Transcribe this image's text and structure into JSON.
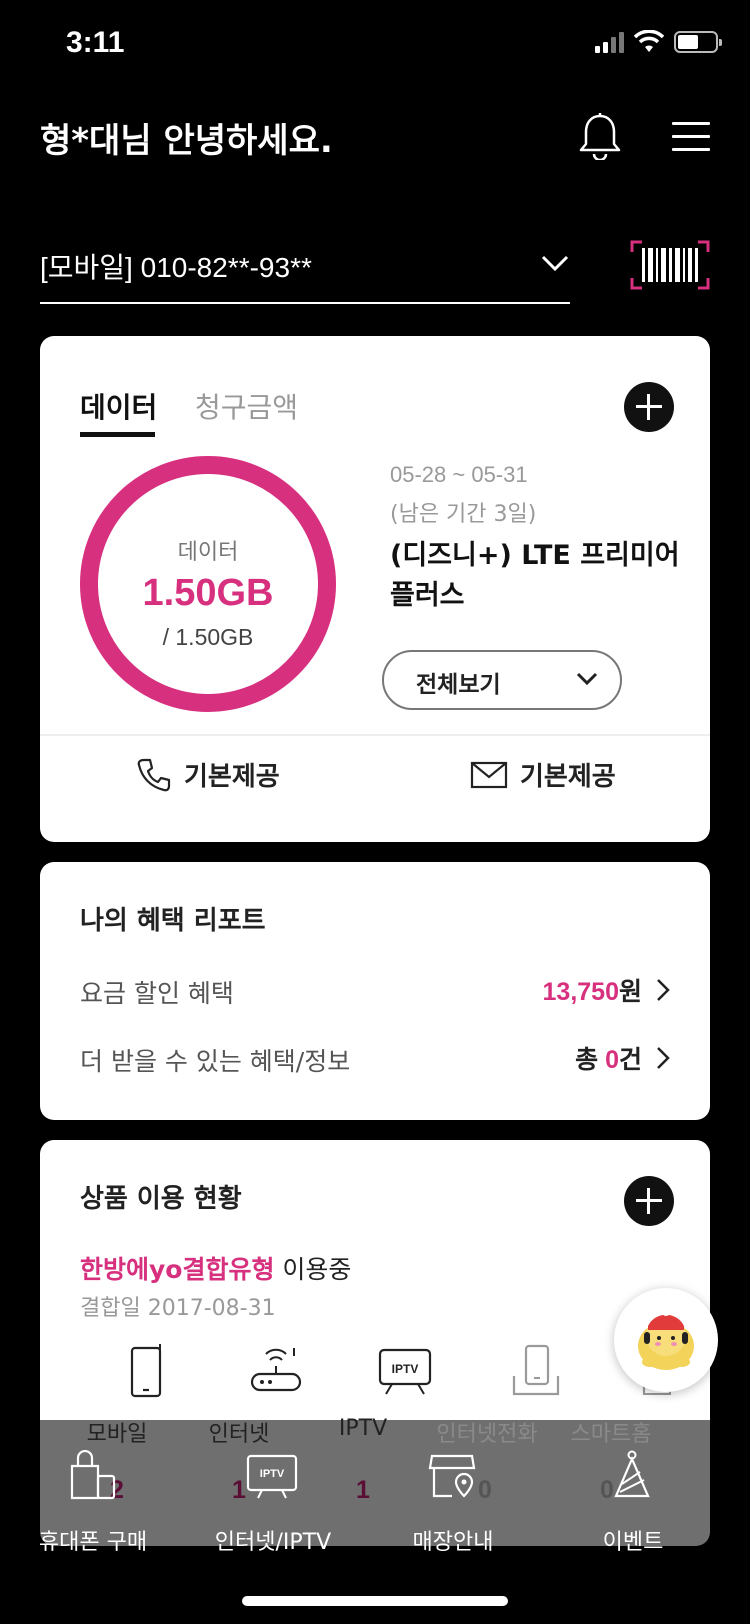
{
  "status_bar": {
    "time": "3:11"
  },
  "header": {
    "greeting": "형*대님 안녕하세요."
  },
  "line_selector": {
    "value": "[모바일] 010-82**-93**"
  },
  "usage_card": {
    "tabs": [
      {
        "label": "데이터",
        "active": true
      },
      {
        "label": "청구금액",
        "active": false
      }
    ],
    "ring": {
      "label": "데이터",
      "value": "1.50GB",
      "total": "/ 1.50GB",
      "fill_fraction": 1.0,
      "color": "#d6307e"
    },
    "period": "05-28 ~ 05-31",
    "remaining": "(남은 기간 3일)",
    "plan_name": "(디즈니+) LTE 프리미어 플러스",
    "view_all_label": "전체보기",
    "voice_label": "기본제공",
    "message_label": "기본제공"
  },
  "benefit_card": {
    "title": "나의 혜택 리포트",
    "rows": [
      {
        "label": "요금 할인 혜택",
        "amount": "13,750",
        "unit": "원"
      },
      {
        "label": "더 받을 수 있는 혜택/정보",
        "prefix": "총 ",
        "amount": "0",
        "unit": "건"
      }
    ]
  },
  "product_card": {
    "title": "상품 이용 현황",
    "bundle_name": "한방에yo결합유형",
    "bundle_suffix": " 이용중",
    "bundle_date": "결합일 2017-08-31",
    "products": [
      {
        "label": "모바일",
        "count": "2",
        "icon": "mobile-icon",
        "active": true
      },
      {
        "label": "인터넷",
        "count": "1",
        "icon": "router-icon",
        "active": true
      },
      {
        "label": "IPTV",
        "count": "1",
        "icon": "iptv-icon",
        "active": true,
        "icon_text": "IPTV"
      },
      {
        "label": "인터넷전화",
        "count": "0",
        "icon": "home-phone-icon",
        "active": false
      },
      {
        "label": "스마트홈",
        "count": "0",
        "icon": "smart-home-icon",
        "active": false
      }
    ]
  },
  "bottom_nav": {
    "items": [
      {
        "label": "휴대폰 구매",
        "icon": "shopping-bag-icon"
      },
      {
        "label": "인터넷/IPTV",
        "icon": "tv-icon",
        "icon_text": "IPTV"
      },
      {
        "label": "매장안내",
        "icon": "store-location-icon"
      },
      {
        "label": "이벤트",
        "icon": "party-hat-icon"
      }
    ]
  },
  "colors": {
    "accent": "#d6307e",
    "background": "#000000"
  }
}
